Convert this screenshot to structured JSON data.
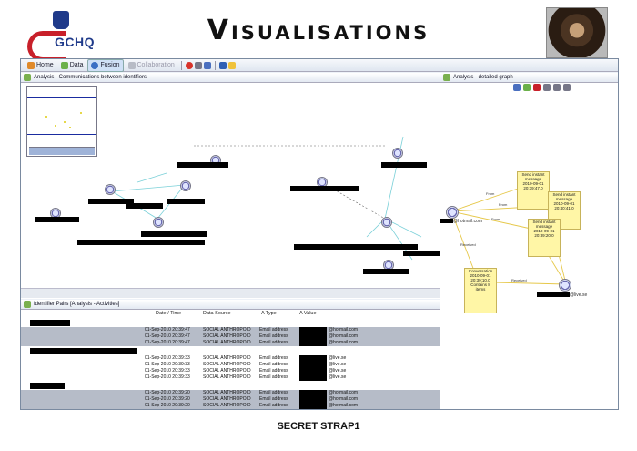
{
  "slide": {
    "title": "Visualisations",
    "logo_text": "GCHQ",
    "footer": "SECRET STRAP1"
  },
  "toolbar": {
    "items": [
      {
        "label": "Home",
        "icon": "home-icon"
      },
      {
        "label": "Data",
        "icon": "data-icon"
      },
      {
        "label": "Fusion",
        "icon": "fusion-icon"
      },
      {
        "label": "Collaboration",
        "icon": "collaboration-icon"
      }
    ]
  },
  "graph_pane": {
    "tab": "Analysis - Communications between identifiers"
  },
  "right_pane": {
    "tab": "Analysis - detailed graph",
    "email_left": "@hotmail.com",
    "email_right": "@live.se",
    "edge_labels": [
      "From",
      "From",
      "From",
      "Received",
      "Received"
    ],
    "boxes": [
      {
        "lines": [
          "Send instant",
          "message",
          "2010-09-01",
          "20:39:47.0"
        ]
      },
      {
        "lines": [
          "Send instant",
          "message",
          "2010-09-01",
          "20:40:41.0"
        ]
      },
      {
        "lines": [
          "Send instant",
          "message",
          "2010-09-01",
          "20:39:20.0"
        ]
      },
      {
        "lines": [
          "Conversation",
          "2010-09-01",
          "20:39:10.0",
          "Contains 8",
          "items"
        ]
      }
    ]
  },
  "table": {
    "tab": "Identifier Pairs [Analysis - Activities]",
    "columns": [
      "Date / Time",
      "Data Source",
      "A Type",
      "A Value"
    ],
    "groups": [
      {
        "rows": [
          {
            "date": "01-Sep-2010 20:39:47",
            "source": "SOCIAL ANTHROPOID",
            "type": "Email address",
            "value": "@hotmail.com",
            "selected": true
          },
          {
            "date": "01-Sep-2010 20:39:47",
            "source": "SOCIAL ANTHROPOID",
            "type": "Email address",
            "value": "@hotmail.com",
            "selected": true
          },
          {
            "date": "01-Sep-2010 20:39:47",
            "source": "SOCIAL ANTHROPOID",
            "type": "Email address",
            "value": "@hotmail.com",
            "selected": true
          }
        ]
      },
      {
        "rows": [
          {
            "date": "01-Sep-2010 20:39:33",
            "source": "SOCIAL ANTHROPOID",
            "type": "Email address",
            "value": "@live.se",
            "selected": false
          },
          {
            "date": "01-Sep-2010 20:39:33",
            "source": "SOCIAL ANTHROPOID",
            "type": "Email address",
            "value": "@live.se",
            "selected": false
          },
          {
            "date": "01-Sep-2010 20:39:33",
            "source": "SOCIAL ANTHROPOID",
            "type": "Email address",
            "value": "@live.se",
            "selected": false
          },
          {
            "date": "01-Sep-2010 20:39:33",
            "source": "SOCIAL ANTHROPOID",
            "type": "Email address",
            "value": "@live.se",
            "selected": false
          }
        ]
      },
      {
        "rows": [
          {
            "date": "01-Sep-2010 20:39:20",
            "source": "SOCIAL ANTHROPOID",
            "type": "Email address",
            "value": "@hotmail.com",
            "selected": true
          },
          {
            "date": "01-Sep-2010 20:39:20",
            "source": "SOCIAL ANTHROPOID",
            "type": "Email address",
            "value": "@hotmail.com",
            "selected": true
          },
          {
            "date": "01-Sep-2010 20:39:20",
            "source": "SOCIAL ANTHROPOID",
            "type": "Email address",
            "value": "@hotmail.com",
            "selected": true
          }
        ]
      }
    ]
  },
  "colors": {
    "accent": "#c8202a",
    "brand": "#1f3a8a",
    "node_highlight": "#fff6a6"
  }
}
